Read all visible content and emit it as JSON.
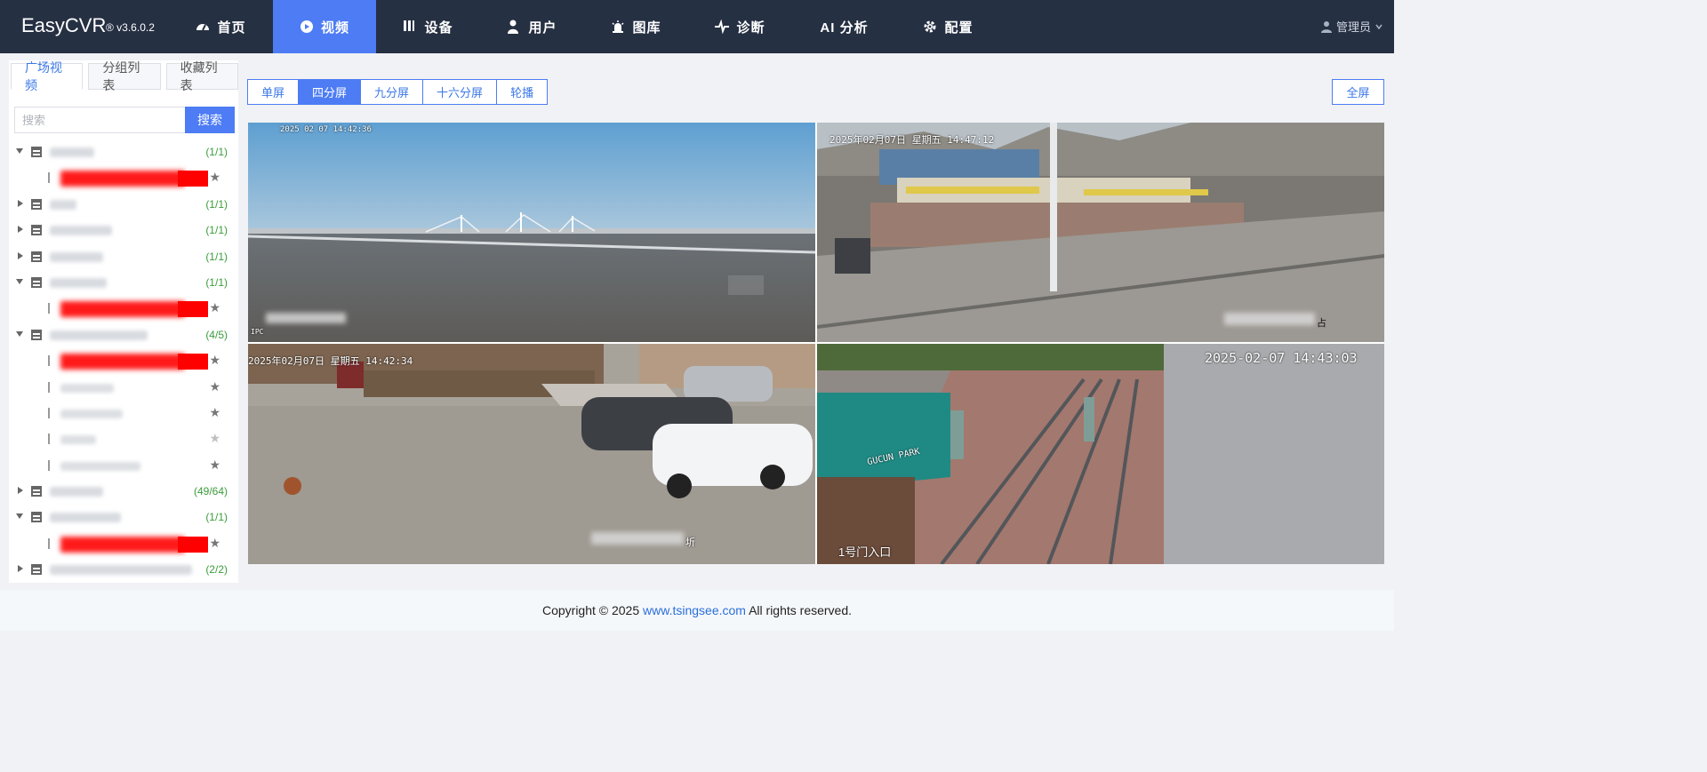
{
  "app": {
    "brand": "EasyCVR",
    "version": "® v3.6.0.2"
  },
  "nav": [
    {
      "label": "首页",
      "icon": "dashboard-icon",
      "active": false,
      "width": 117
    },
    {
      "label": "视频",
      "icon": "play-circle-icon",
      "active": true,
      "width": 116
    },
    {
      "label": "设备",
      "icon": "device-icon",
      "active": false,
      "width": 117
    },
    {
      "label": "用户",
      "icon": "user-icon",
      "active": false,
      "width": 117
    },
    {
      "label": "图库",
      "icon": "alarm-icon",
      "active": false,
      "width": 117
    },
    {
      "label": "诊断",
      "icon": "pulse-icon",
      "active": false,
      "width": 117
    },
    {
      "label": "AI 分析",
      "icon": "",
      "active": false,
      "width": 117
    },
    {
      "label": "配置",
      "icon": "gear-icon",
      "active": false,
      "width": 117
    }
  ],
  "user": {
    "name": "管理员"
  },
  "sidebar": {
    "tabs": [
      {
        "label": "广场视频",
        "active": true
      },
      {
        "label": "分组列表",
        "active": false
      },
      {
        "label": "收藏列表",
        "active": false
      }
    ],
    "search_placeholder": "搜索",
    "search_button": "搜索",
    "tree": [
      {
        "type": "group",
        "expanded": true,
        "count": "(1/1)"
      },
      {
        "type": "channel",
        "redacted": true
      },
      {
        "type": "group",
        "expanded": false,
        "count": "(1/1)"
      },
      {
        "type": "group",
        "expanded": false,
        "count": "(1/1)"
      },
      {
        "type": "group",
        "expanded": false,
        "count": "(1/1)"
      },
      {
        "type": "group",
        "expanded": true,
        "count": "(1/1)"
      },
      {
        "type": "channel",
        "redacted": true
      },
      {
        "type": "group",
        "expanded": true,
        "count": "(4/5)"
      },
      {
        "type": "channel",
        "redacted": true
      },
      {
        "type": "channel",
        "redacted": false
      },
      {
        "type": "channel",
        "redacted": false
      },
      {
        "type": "channel",
        "redacted": false,
        "dim": true
      },
      {
        "type": "channel",
        "redacted": false
      },
      {
        "type": "group",
        "expanded": false,
        "count": "(49/64)"
      },
      {
        "type": "group",
        "expanded": true,
        "count": "(1/1)"
      },
      {
        "type": "channel",
        "redacted": true
      },
      {
        "type": "group",
        "expanded": false,
        "count": "(2/2)"
      }
    ]
  },
  "split_modes": [
    {
      "label": "单屏",
      "active": false
    },
    {
      "label": "四分屏",
      "active": true
    },
    {
      "label": "九分屏",
      "active": false
    },
    {
      "label": "十六分屏",
      "active": false
    },
    {
      "label": "轮播",
      "active": false
    }
  ],
  "fullscreen_label": "全屏",
  "videos": {
    "v1_timestamp": "2025 02 07 14:42:36",
    "v1_corner": "IPC",
    "v2_timestamp": "2025年02月07日 星期五 14:47:12",
    "v2_suffix": "占",
    "v3_timestamp": "2025年02月07日 星期五 14:42:34",
    "v3_suffix": "圻",
    "v4_timestamp": "2025-02-07 14:43:03",
    "v4_label": "1号门入口",
    "v4_sign": "GUCUN PARK"
  },
  "footer": {
    "prefix": "Copyright © 2025",
    "link": "www.tsingsee.com",
    "suffix": "All rights reserved."
  },
  "colors": {
    "nav_bg": "#263043",
    "accent": "#4d7cf4",
    "count_green": "#3a9c3a",
    "redact": "#ff0000"
  }
}
